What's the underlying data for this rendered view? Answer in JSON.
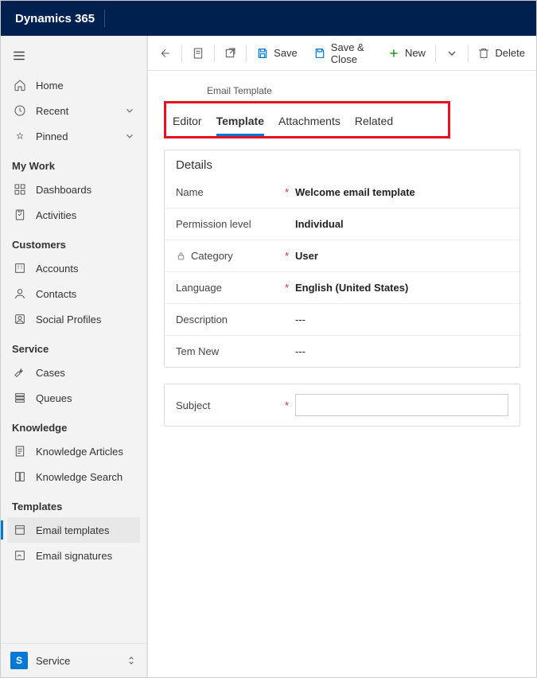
{
  "app_title": "Dynamics 365",
  "sidebar": {
    "home": "Home",
    "recent": "Recent",
    "pinned": "Pinned",
    "groups": [
      {
        "header": "My Work",
        "items": [
          {
            "id": "dashboards",
            "label": "Dashboards"
          },
          {
            "id": "activities",
            "label": "Activities"
          }
        ]
      },
      {
        "header": "Customers",
        "items": [
          {
            "id": "accounts",
            "label": "Accounts"
          },
          {
            "id": "contacts",
            "label": "Contacts"
          },
          {
            "id": "social-profiles",
            "label": "Social Profiles"
          }
        ]
      },
      {
        "header": "Service",
        "items": [
          {
            "id": "cases",
            "label": "Cases"
          },
          {
            "id": "queues",
            "label": "Queues"
          }
        ]
      },
      {
        "header": "Knowledge",
        "items": [
          {
            "id": "knowledge-articles",
            "label": "Knowledge Articles"
          },
          {
            "id": "knowledge-search",
            "label": "Knowledge Search"
          }
        ]
      },
      {
        "header": "Templates",
        "items": [
          {
            "id": "email-templates",
            "label": "Email templates",
            "selected": true
          },
          {
            "id": "email-signatures",
            "label": "Email signatures"
          }
        ]
      }
    ],
    "footer": {
      "badge": "S",
      "app": "Service"
    }
  },
  "cmdbar": {
    "save": "Save",
    "save_close": "Save & Close",
    "new": "New",
    "delete": "Delete"
  },
  "record": {
    "entity": "Email Template",
    "tabs": {
      "editor": "Editor",
      "template": "Template",
      "attachments": "Attachments",
      "related": "Related"
    },
    "details_header": "Details",
    "fields": {
      "name": {
        "label": "Name",
        "value": "Welcome email template",
        "required": true
      },
      "permission": {
        "label": "Permission level",
        "value": "Individual"
      },
      "category": {
        "label": "Category",
        "value": "User",
        "required": true,
        "locked": true
      },
      "language": {
        "label": "Language",
        "value": "English (United States)",
        "required": true
      },
      "description": {
        "label": "Description",
        "value": "---"
      },
      "temnew": {
        "label": "Tem New",
        "value": "---"
      },
      "subject": {
        "label": "Subject",
        "value": "",
        "required": true
      }
    }
  }
}
